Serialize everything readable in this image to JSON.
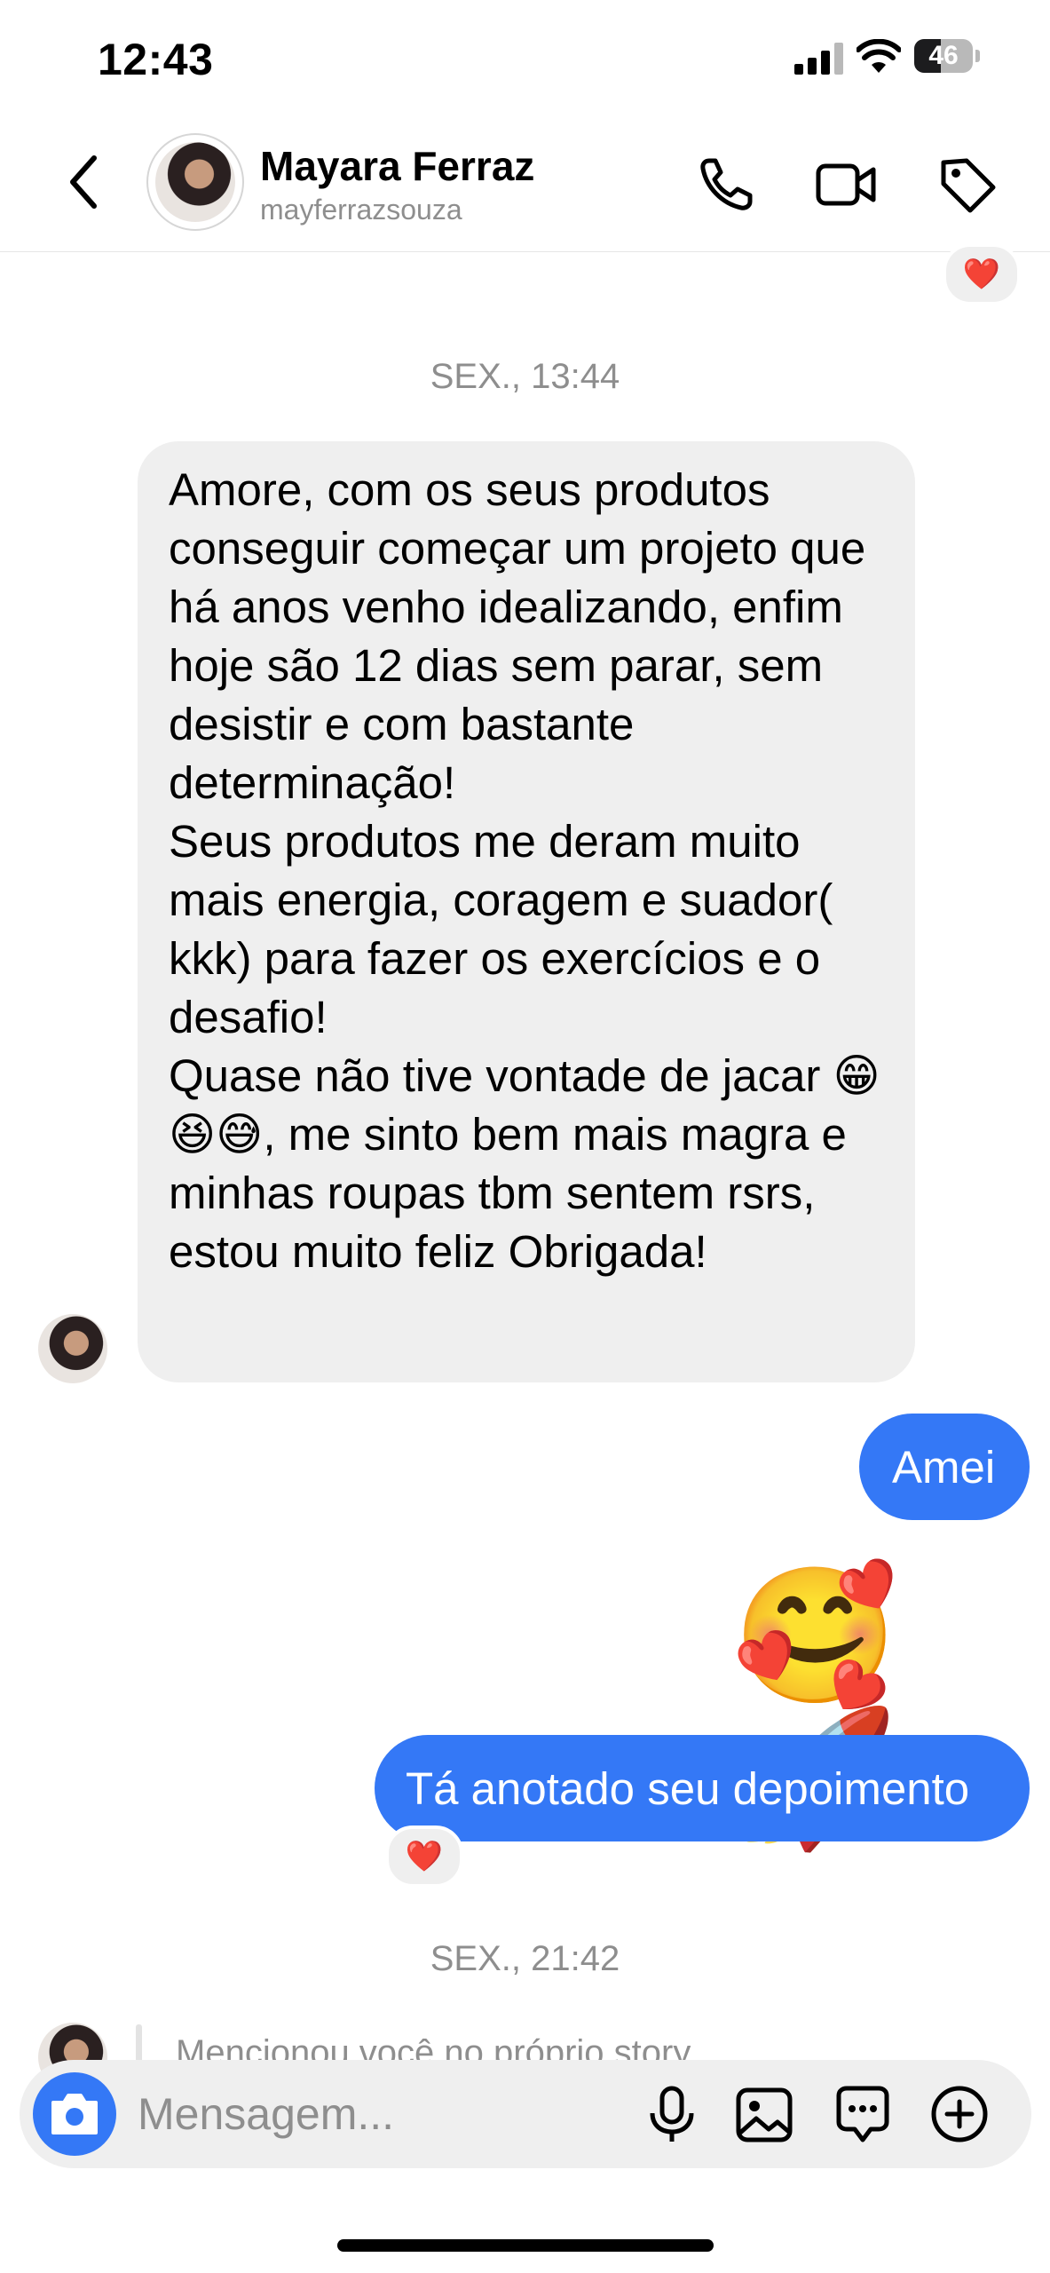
{
  "status_bar": {
    "time": "12:43",
    "battery_level": "46",
    "battery_fraction": 0.46
  },
  "header": {
    "contact_name": "Mayara Ferraz",
    "contact_handle": "mayferrazsouza",
    "icons": [
      "chevron-left-icon",
      "phone-icon",
      "video-camera-icon",
      "tag-icon"
    ]
  },
  "conversation": {
    "top_reaction": "❤️",
    "timestamp_1": "SEX., 13:44",
    "incoming_message": {
      "p1": "Amore, com os seus produtos conseguir começar um projeto que há anos venho idealizando, enfim hoje são 12 dias sem parar, sem desistir e com bastante determinação!",
      "p2": "Seus produtos me deram muito mais energia, coragem e suador( kkk) para fazer os exercícios e o desafio!",
      "p3": "Quase não tive vontade de jacar 😁😆😅, me sinto bem mais magra e minhas roupas tbm sentem rsrs, estou muito feliz Obrigada!"
    },
    "outgoing_1": "Amei",
    "outgoing_emojis": "🥰🚀",
    "outgoing_2": "Tá anotado seu depoimento",
    "outgoing_2_reaction": "❤️",
    "timestamp_2": "SEX., 21:42",
    "story_mention": "Mencionou você no próprio story"
  },
  "composer": {
    "placeholder": "Mensagem...",
    "icons": [
      "camera-icon",
      "microphone-icon",
      "image-icon",
      "sticker-icon",
      "plus-circle-icon"
    ]
  },
  "colors": {
    "accent": "#3478f6",
    "incoming_bubble": "#efefef",
    "muted_text": "#8e8e8e"
  }
}
